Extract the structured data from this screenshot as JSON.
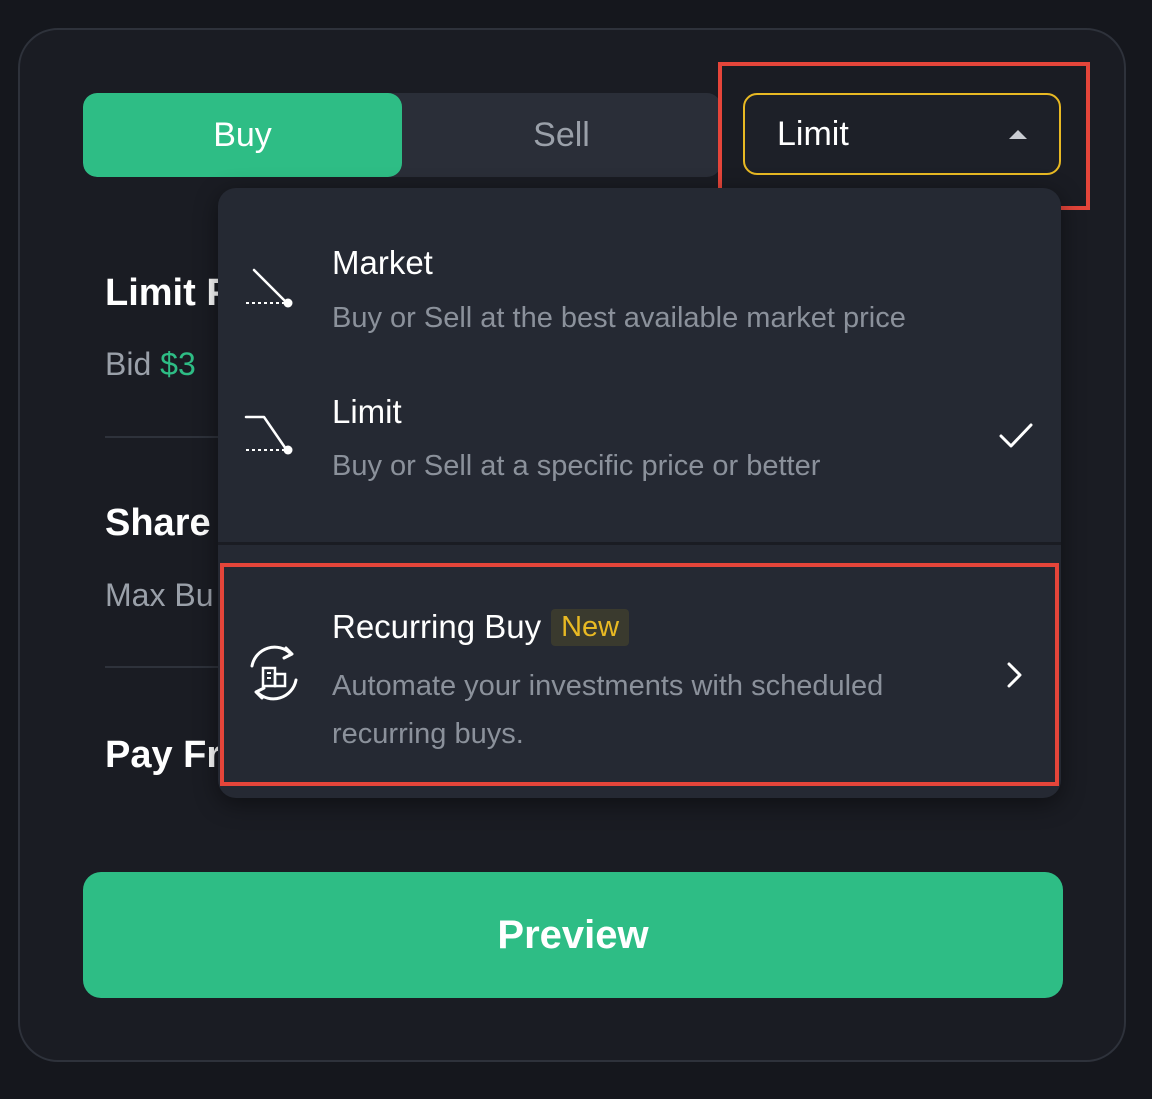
{
  "side_toggle": {
    "buy_label": "Buy",
    "sell_label": "Sell",
    "selected": "Buy"
  },
  "order_type_select": {
    "value": "Limit",
    "expanded": true
  },
  "form": {
    "limit_price_label": "Limit P",
    "bid_label": "Bid",
    "bid_value": "$3",
    "shares_label": "Share",
    "max_buy_label": "Max Bu",
    "pay_from_label": "Pay Fr"
  },
  "dropdown": {
    "options": [
      {
        "title": "Market",
        "description": "Buy or Sell at the best available market price",
        "icon": "market-order-icon",
        "selected": false
      },
      {
        "title": "Limit",
        "description": "Buy or Sell at a specific price or better",
        "icon": "limit-order-icon",
        "selected": true
      }
    ],
    "recurring": {
      "title": "Recurring Buy",
      "badge": "New",
      "description_line1": "Automate your investments with scheduled",
      "description_line2": "recurring buys.",
      "icon": "recurring-buy-icon"
    }
  },
  "preview_label": "Preview",
  "colors": {
    "accent_green": "#2ebd85",
    "highlight_yellow": "#e8b923",
    "annotation_red": "#e5453a",
    "background": "#15171d",
    "menu_bg": "#252933"
  }
}
